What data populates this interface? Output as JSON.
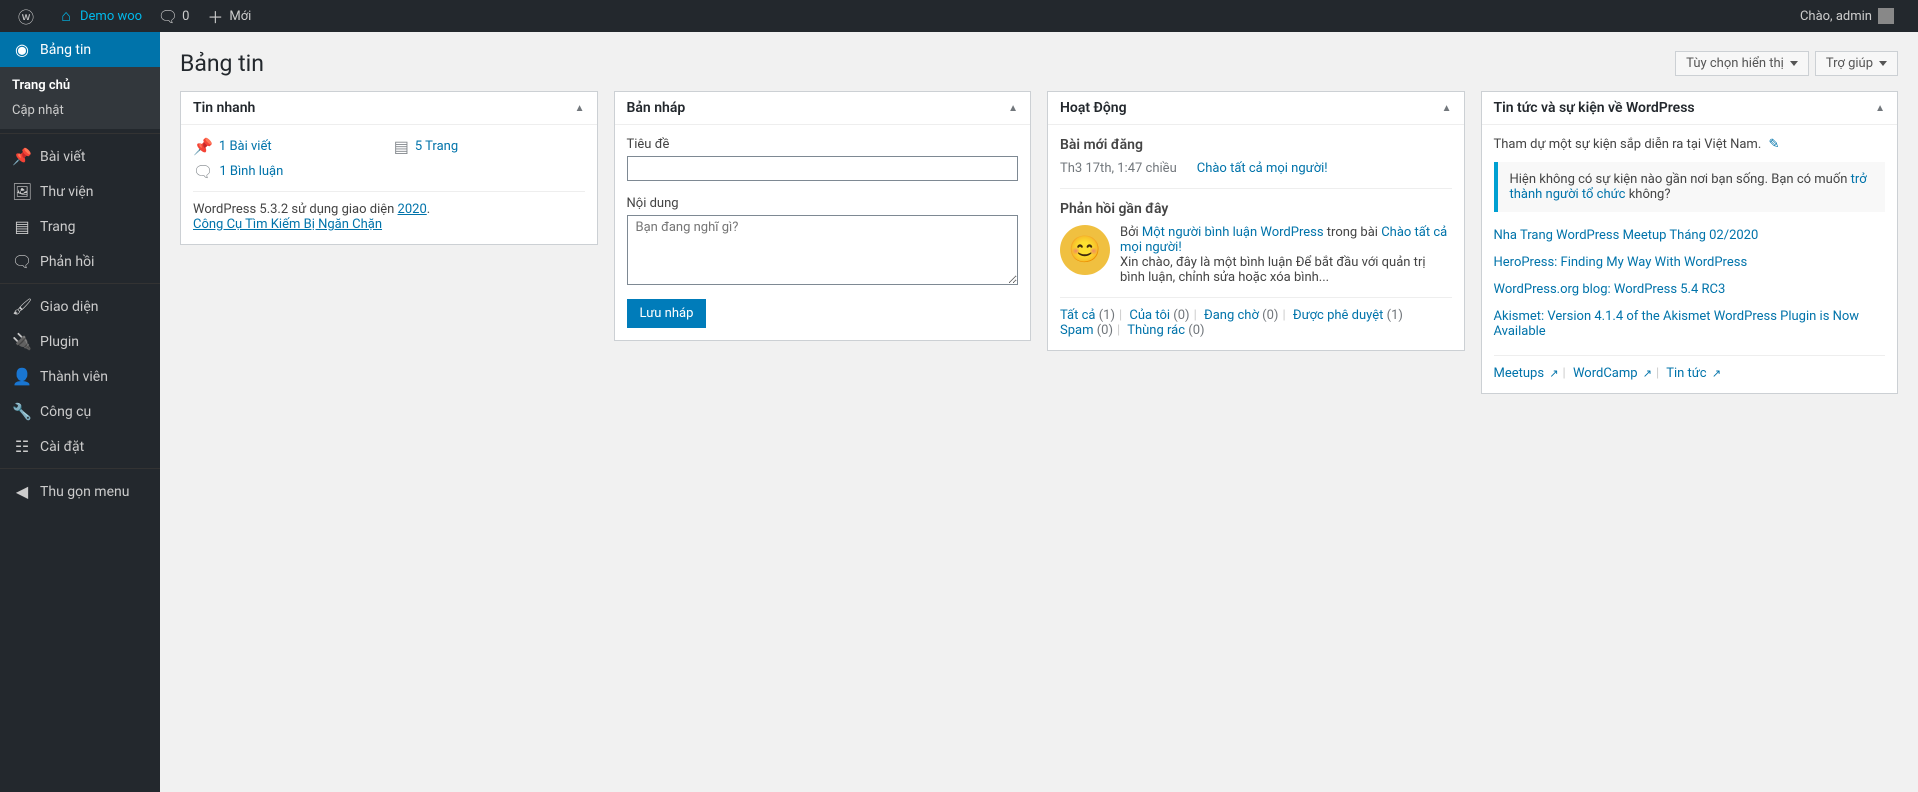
{
  "topbar": {
    "site_name": "Demo woo",
    "comments_count": "0",
    "new_label": "Mới",
    "greeting": "Chào, admin"
  },
  "sidebar": {
    "items": [
      {
        "label": "Bảng tin"
      },
      {
        "label": "Trang chủ"
      },
      {
        "label": "Cập nhật"
      },
      {
        "label": "Bài viết"
      },
      {
        "label": "Thư viện"
      },
      {
        "label": "Trang"
      },
      {
        "label": "Phản hồi"
      },
      {
        "label": "Giao diện"
      },
      {
        "label": "Plugin"
      },
      {
        "label": "Thành viên"
      },
      {
        "label": "Công cụ"
      },
      {
        "label": "Cài đặt"
      },
      {
        "label": "Thu gọn menu"
      }
    ]
  },
  "page": {
    "title": "Bảng tin",
    "screen_options": "Tùy chọn hiển thị",
    "help": "Trợ giúp"
  },
  "quick": {
    "title": "Tin nhanh",
    "posts": "1 Bài viết",
    "pages": "5 Trang",
    "comments": "1 Bình luận",
    "wp_version_prefix": "WordPress 5.3.2 sử dụng giao diện ",
    "theme": "2020",
    "search_blocked": "Công Cụ Tìm Kiếm Bị Ngăn Chặn"
  },
  "draft": {
    "title": "Bản nháp",
    "title_label": "Tiêu đề",
    "content_label": "Nội dung",
    "placeholder": "Bạn đang nghĩ gì?",
    "save": "Lưu nháp"
  },
  "activity": {
    "title": "Hoạt Động",
    "recent_heading": "Bài mới đăng",
    "recent_date": "Th3 17th, 1:47 chiều",
    "recent_link": "Chào tất cả mọi người!",
    "comments_heading": "Phản hồi gần đây",
    "comment_by": "Bởi ",
    "comment_author": "Một người bình luận WordPress",
    "comment_on": " trong bài ",
    "comment_post": "Chào tất cả mọi người!",
    "comment_body": "Xin chào, đây là một bình luận Để bắt đầu với quản trị bình luận, chỉnh sửa hoặc xóa bình...",
    "filters": {
      "all": "Tất cả",
      "all_count": "(1)",
      "mine": "Của tôi",
      "mine_count": "(0)",
      "pending": "Đang chờ",
      "pending_count": "(0)",
      "approved": "Được phê duyệt",
      "approved_count": "(1)",
      "spam": "Spam",
      "spam_count": "(0)",
      "trash": "Thùng rác",
      "trash_count": "(0)"
    }
  },
  "news": {
    "title": "Tin tức và sự kiện về WordPress",
    "attend": "Tham dự một sự kiện sắp diễn ra tại Việt Nam.",
    "notice_text": "Hiện không có sự kiện nào gần nơi bạn sống. Bạn có muốn ",
    "notice_link": "trở thành người tổ chức",
    "notice_suffix": " không?",
    "items": [
      "Nha Trang WordPress Meetup Tháng 02/2020",
      "HeroPress: Finding My Way With WordPress",
      "WordPress.org blog: WordPress 5.4 RC3",
      "Akismet: Version 4.1.4 of the Akismet WordPress Plugin is Now Available"
    ],
    "footer": {
      "meetups": "Meetups",
      "wordcamp": "WordCamp",
      "news": "Tin tức"
    }
  }
}
